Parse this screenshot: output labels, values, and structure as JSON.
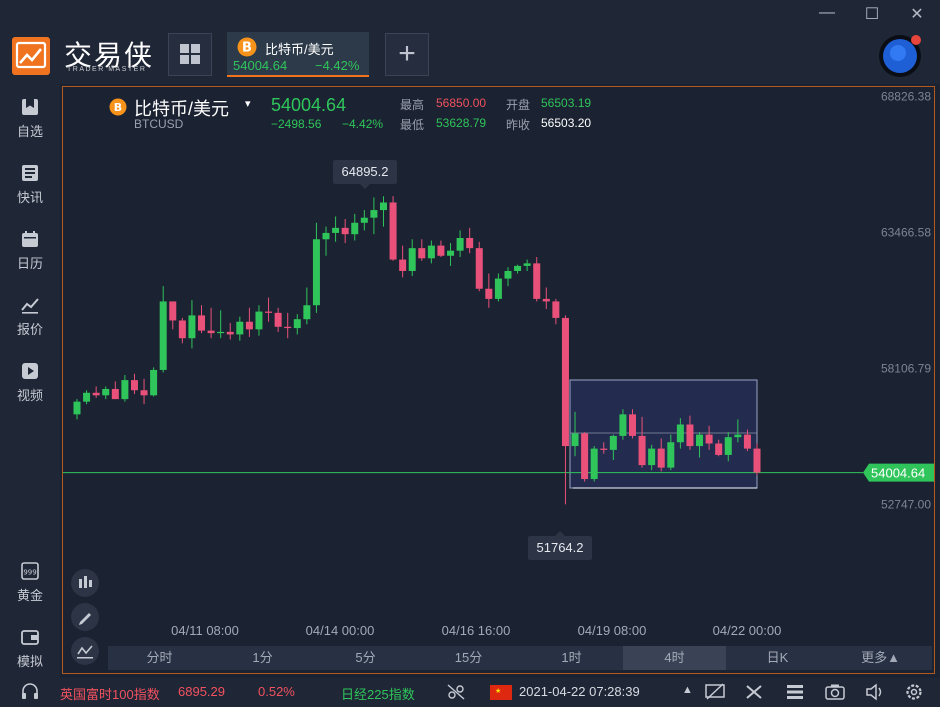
{
  "brand": {
    "name": "交易侠",
    "tagline": "TRADER MASTER"
  },
  "tab": {
    "title": "比特币/美元",
    "price": "54004.64",
    "change": "−4.42%"
  },
  "window_controls": {
    "minimize": "—",
    "maximize": "☐",
    "close": "✕"
  },
  "sidebar": {
    "items": [
      {
        "label": "自选",
        "icon": "bookmark-icon"
      },
      {
        "label": "快讯",
        "icon": "news-icon"
      },
      {
        "label": "日历",
        "icon": "calendar-icon"
      },
      {
        "label": "报价",
        "icon": "quote-chart-icon"
      },
      {
        "label": "视频",
        "icon": "video-icon"
      },
      {
        "label": "黄金",
        "icon": "gold-icon"
      },
      {
        "label": "模拟",
        "icon": "wallet-icon"
      }
    ]
  },
  "symbol": {
    "name": "比特币/美元",
    "code": "BTCUSD",
    "price": "54004.64",
    "change": "−2498.56",
    "change_pct": "−4.42%",
    "high_label": "最高",
    "high": "56850.00",
    "open_label": "开盘",
    "open": "56503.19",
    "low_label": "最低",
    "low": "53628.79",
    "prev_label": "昨收",
    "prev": "56503.20"
  },
  "chart_data": {
    "type": "candlestick",
    "y_ticks": [
      "68826.38",
      "63466.58",
      "58106.79",
      "52747.00"
    ],
    "x_ticks": [
      "04/11 08:00",
      "04/14 00:00",
      "04/16 16:00",
      "04/19 08:00",
      "04/22 00:00"
    ],
    "current_price": "54004.64",
    "max_annotation": "64895.2",
    "min_annotation": "51764.2",
    "up_color": "#2fc55b",
    "down_color": "#e9517a",
    "ohlc": [
      [
        56300,
        56900,
        56100,
        56800
      ],
      [
        56800,
        57250,
        56700,
        57150
      ],
      [
        57150,
        57400,
        56950,
        57050
      ],
      [
        57050,
        57400,
        56900,
        57300
      ],
      [
        57300,
        57600,
        56950,
        56900
      ],
      [
        56900,
        57850,
        56800,
        57650
      ],
      [
        57650,
        57900,
        57100,
        57250
      ],
      [
        57250,
        57700,
        56700,
        57050
      ],
      [
        57050,
        58150,
        57000,
        58050
      ],
      [
        58050,
        61350,
        57950,
        60750
      ],
      [
        60750,
        60300,
        59650,
        60000
      ],
      [
        60000,
        60100,
        59100,
        59300
      ],
      [
        59300,
        60800,
        58900,
        60200
      ],
      [
        60200,
        60600,
        59500,
        59600
      ],
      [
        59600,
        60500,
        59300,
        59500
      ],
      [
        59500,
        60400,
        59300,
        59550
      ],
      [
        59550,
        59900,
        59250,
        59450
      ],
      [
        59450,
        60150,
        59200,
        59950
      ],
      [
        59950,
        60500,
        59350,
        59650
      ],
      [
        59650,
        60600,
        59400,
        60350
      ],
      [
        60350,
        60900,
        59950,
        60300
      ],
      [
        60300,
        60500,
        59550,
        59750
      ],
      [
        59750,
        60300,
        59300,
        59700
      ],
      [
        59700,
        60250,
        59450,
        60050
      ],
      [
        60050,
        61300,
        59850,
        60600
      ],
      [
        60600,
        63850,
        60300,
        63200
      ],
      [
        63200,
        63700,
        62550,
        63450
      ],
      [
        63450,
        64100,
        63100,
        63650
      ],
      [
        63650,
        64000,
        63050,
        63400
      ],
      [
        63400,
        64200,
        63150,
        63850
      ],
      [
        63850,
        64350,
        63550,
        64050
      ],
      [
        64050,
        64850,
        63400,
        64350
      ],
      [
        64350,
        64895,
        63700,
        64650
      ],
      [
        64650,
        64900,
        62350,
        62400
      ],
      [
        62400,
        62950,
        61700,
        61950
      ],
      [
        61950,
        63200,
        61750,
        62850
      ],
      [
        62850,
        63200,
        62350,
        62450
      ],
      [
        62450,
        63150,
        62250,
        62950
      ],
      [
        62950,
        63150,
        62500,
        62550
      ],
      [
        62550,
        63050,
        62150,
        62750
      ],
      [
        62750,
        63550,
        62500,
        63250
      ],
      [
        63250,
        63650,
        62650,
        62850
      ],
      [
        62850,
        63100,
        61150,
        61250
      ],
      [
        61250,
        61850,
        60500,
        60850
      ],
      [
        60850,
        61850,
        60750,
        61650
      ],
      [
        61650,
        62100,
        61350,
        61950
      ],
      [
        61950,
        62200,
        61850,
        62150
      ],
      [
        62150,
        62400,
        61950,
        62250
      ],
      [
        62250,
        62500,
        60750,
        60850
      ],
      [
        60850,
        61300,
        60450,
        60750
      ],
      [
        60750,
        60850,
        59850,
        60100
      ],
      [
        60100,
        60200,
        52750,
        55050
      ],
      [
        55050,
        56400,
        54650,
        55550
      ],
      [
        55550,
        55600,
        53650,
        53750
      ],
      [
        53750,
        55050,
        53650,
        54950
      ],
      [
        54950,
        55200,
        54750,
        54900
      ],
      [
        54900,
        55500,
        54500,
        55450
      ],
      [
        55450,
        56500,
        55300,
        56300
      ],
      [
        56300,
        56500,
        55350,
        55450
      ],
      [
        55450,
        56200,
        54200,
        54300
      ],
      [
        54300,
        55100,
        54100,
        54950
      ],
      [
        54950,
        55350,
        54050,
        54200
      ],
      [
        54200,
        55500,
        54100,
        55200
      ],
      [
        55200,
        56150,
        54950,
        55900
      ],
      [
        55900,
        56250,
        54900,
        55050
      ],
      [
        55050,
        55600,
        54600,
        55500
      ],
      [
        55500,
        55850,
        54900,
        55150
      ],
      [
        55150,
        55300,
        54650,
        54700
      ],
      [
        54700,
        55600,
        54450,
        55400
      ],
      [
        55400,
        56100,
        55200,
        55500
      ],
      [
        55500,
        55700,
        54850,
        54950
      ],
      [
        54950,
        55150,
        53900,
        54004.64
      ]
    ]
  },
  "chart_tools": [
    "candle-type-icon",
    "draw-pen-icon",
    "indicator-icon"
  ],
  "timeframes": [
    {
      "label": "分时"
    },
    {
      "label": "1分"
    },
    {
      "label": "5分"
    },
    {
      "label": "15分"
    },
    {
      "label": "1时"
    },
    {
      "label": "4时"
    },
    {
      "label": "日K"
    },
    {
      "label": "更多▲"
    }
  ],
  "active_timeframe": "4时",
  "statusbar": {
    "index1_name": "英国富时100指数",
    "index1_value": "6895.29",
    "index1_change": "0.52%",
    "index2_name": "日经225指数",
    "datetime": "2021-04-22 07:28:39"
  }
}
